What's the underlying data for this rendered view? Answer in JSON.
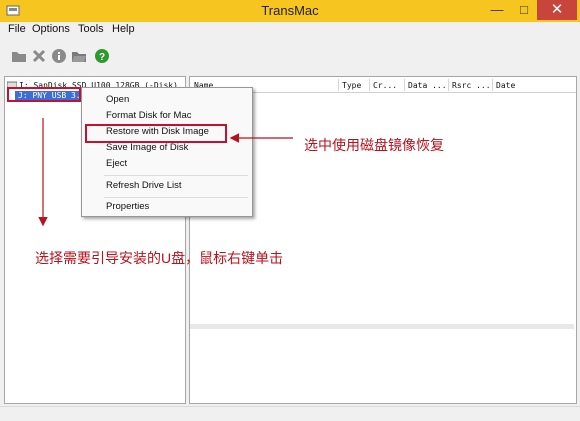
{
  "window": {
    "title": "TransMac",
    "minimize": "—",
    "maximize": "□",
    "close": "✕"
  },
  "menubar": {
    "items": [
      "File",
      "Options",
      "Tools",
      "Help"
    ]
  },
  "toolbar": {
    "icons": [
      "folder-icon",
      "delete-x-icon",
      "info-icon",
      "folder-open-icon",
      "help-icon"
    ]
  },
  "drives": [
    {
      "label": "I: SanDisk SSD U100 128GB (-Disk)"
    },
    {
      "label": "J: PNY USB 3."
    }
  ],
  "file_list": {
    "columns": [
      "Name",
      "Type",
      "Cr...",
      "Data ...",
      "Rsrc ...",
      "Date"
    ]
  },
  "context_menu": {
    "items": [
      "Open",
      "Format Disk for Mac",
      "Restore with Disk Image",
      "Save Image of Disk",
      "Eject",
      "Refresh Drive List",
      "Properties"
    ]
  },
  "annotations": {
    "restore_note": "选中使用磁盘镜像恢复",
    "select_note": "选择需要引导安装的U盘，鼠标右键单击",
    "color": "#b8121c"
  },
  "colors": {
    "window_frame": "#f7c51f",
    "close_button": "#c7453a",
    "selection": "#3b6fd4"
  }
}
